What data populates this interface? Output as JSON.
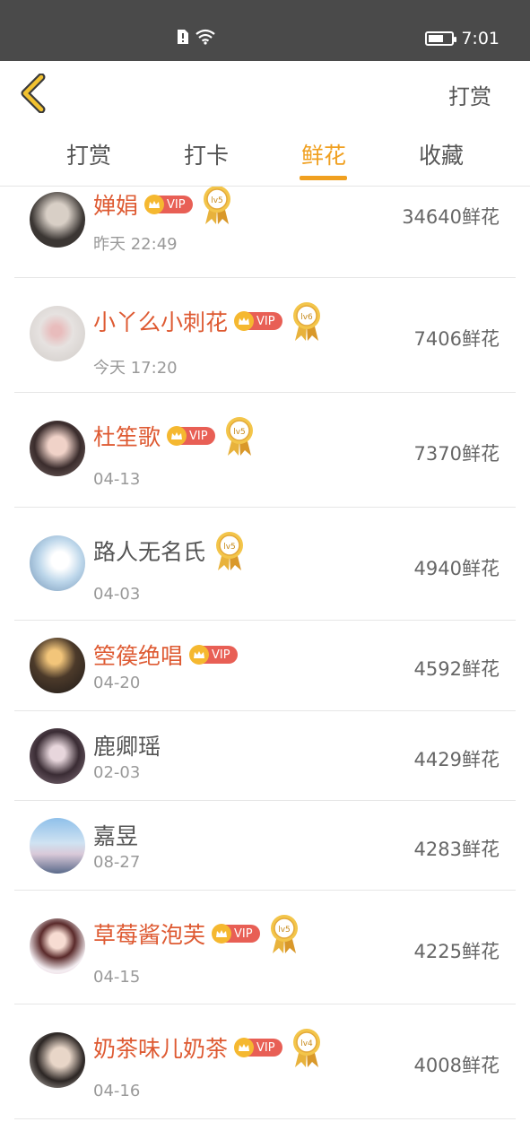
{
  "status_bar": {
    "time": "7:01"
  },
  "header": {
    "back_icon": "chevron-left-icon",
    "action_label": "打赏"
  },
  "tabs": [
    {
      "label": "打赏"
    },
    {
      "label": "打卡"
    },
    {
      "label": "鲜花"
    },
    {
      "label": "收藏"
    }
  ],
  "colors": {
    "accent": "#f0a020",
    "vip_name": "#de5a32",
    "vip_badge": "#e85f55"
  },
  "rows": [
    {
      "name": "婵娟",
      "vip": true,
      "vip_label": "VIP",
      "level": "lv5",
      "date": "昨天 22:49",
      "count": "34640鲜花"
    },
    {
      "name": "小丫么小刺花",
      "vip": true,
      "vip_label": "VIP",
      "level": "lv6",
      "date": "今天 17:20",
      "count": "7406鲜花"
    },
    {
      "name": "杜笙歌",
      "vip": true,
      "vip_label": "VIP",
      "level": "lv5",
      "date": "04-13",
      "count": "7370鲜花"
    },
    {
      "name": "路人无名氏",
      "vip": false,
      "level": "lv5",
      "date": "04-03",
      "count": "4940鲜花"
    },
    {
      "name": "箜篌绝唱",
      "vip": true,
      "vip_label": "VIP",
      "date": "04-20",
      "count": "4592鲜花"
    },
    {
      "name": "鹿卿瑶",
      "vip": false,
      "date": "02-03",
      "count": "4429鲜花"
    },
    {
      "name": "嘉昱",
      "vip": false,
      "date": "08-27",
      "count": "4283鲜花"
    },
    {
      "name": "草莓酱泡芙",
      "vip": true,
      "vip_label": "VIP",
      "level": "lv5",
      "date": "04-15",
      "count": "4225鲜花"
    },
    {
      "name": "奶茶味儿奶茶",
      "vip": true,
      "vip_label": "VIP",
      "level": "lv4",
      "date": "04-16",
      "count": "4008鲜花"
    }
  ]
}
